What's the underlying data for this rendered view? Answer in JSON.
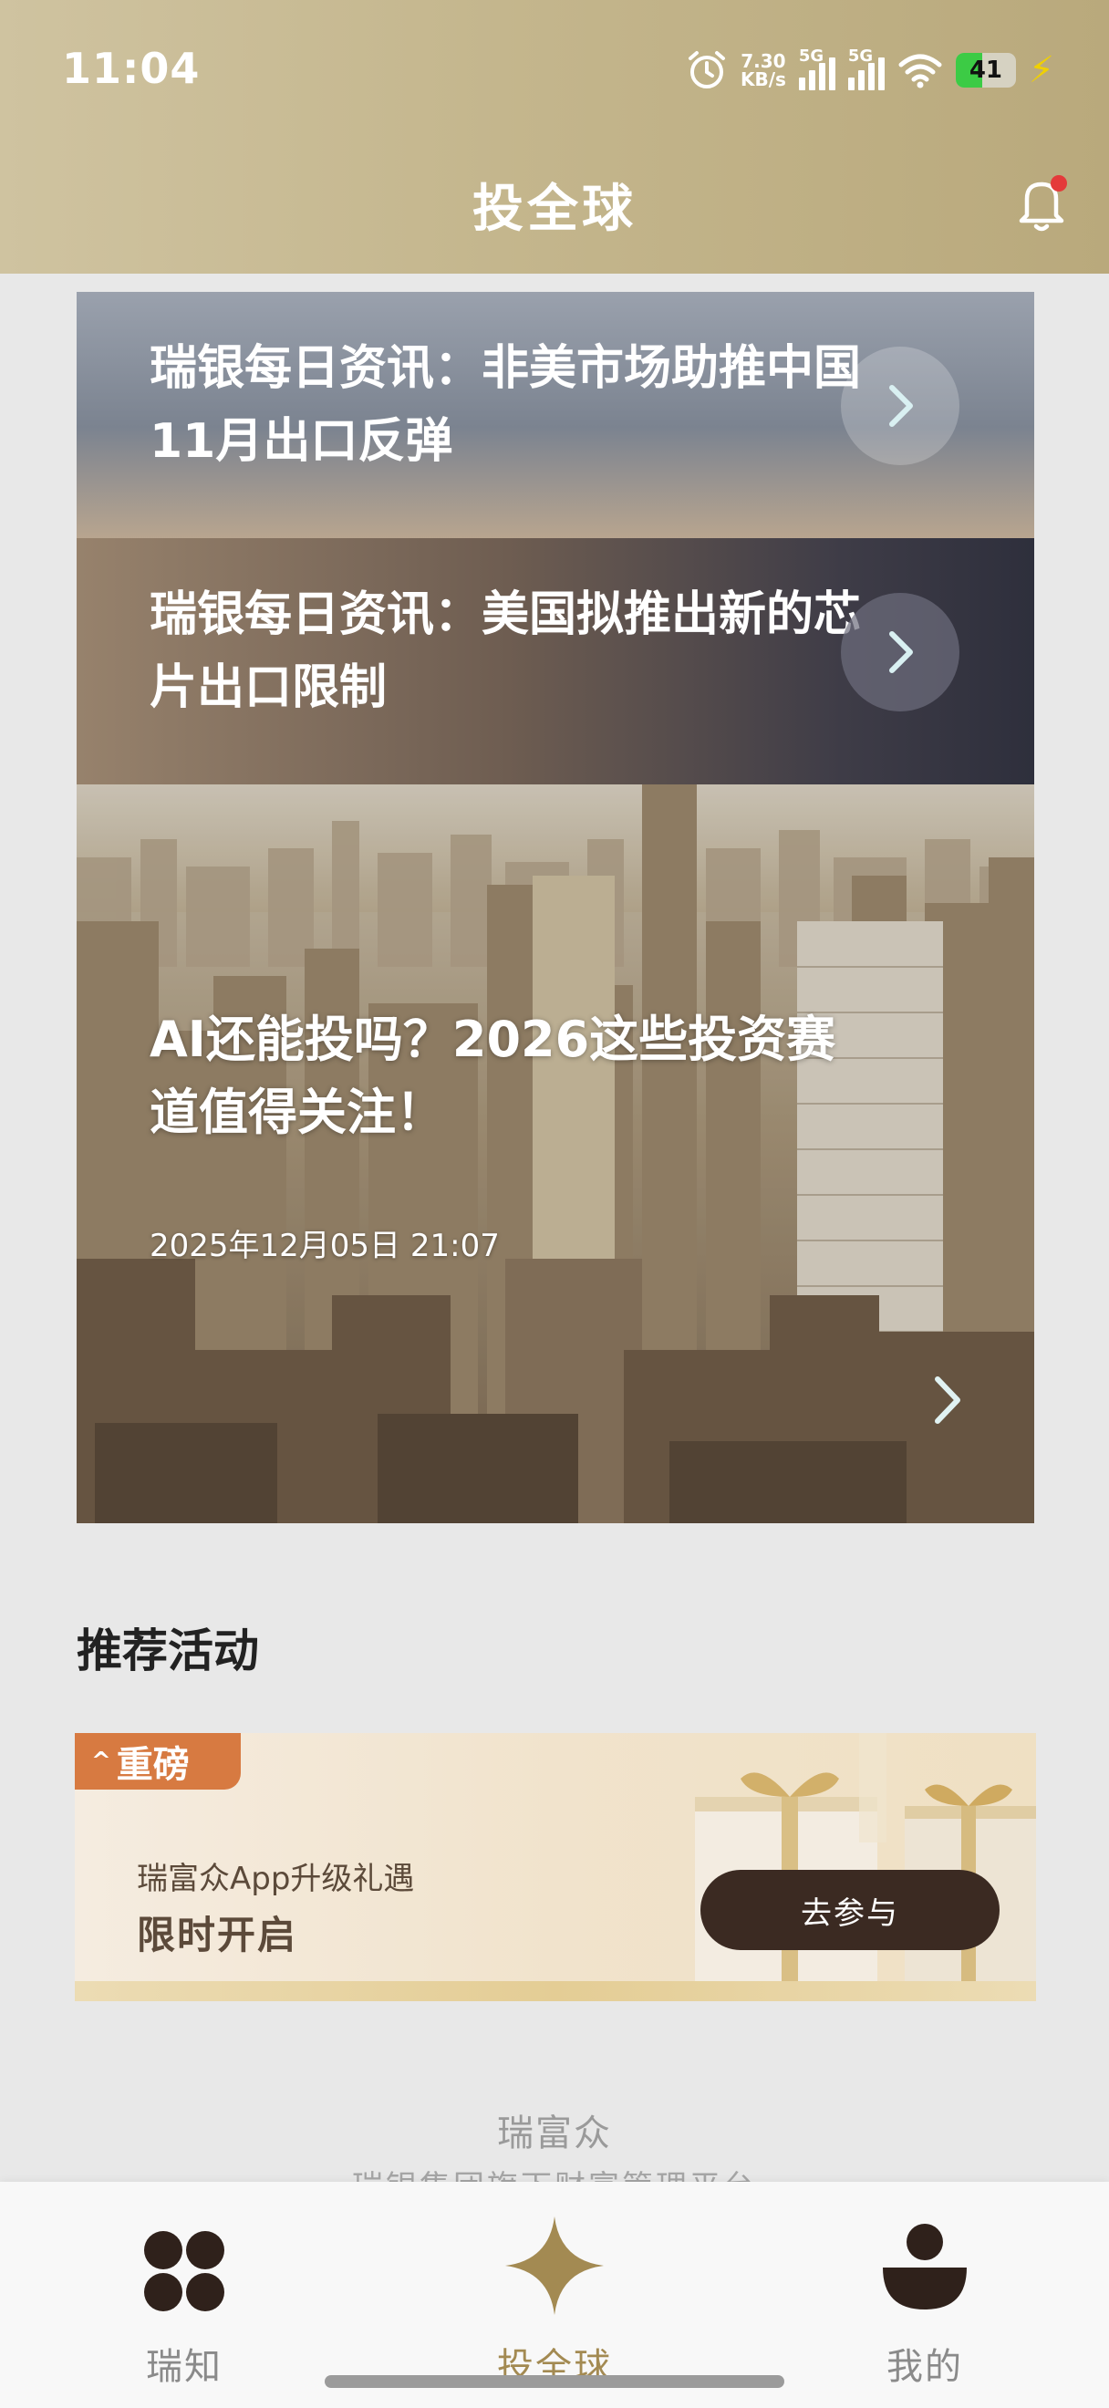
{
  "status_bar": {
    "time": "11:04",
    "net_speed_value": "7.30",
    "net_speed_unit": "KB/s",
    "signal1_label": "5G",
    "signal2_label": "5G",
    "battery": "41",
    "battery_level": 0.41
  },
  "header": {
    "title": "投全球",
    "bell_icon": "bell-icon",
    "has_notification": true
  },
  "news": [
    {
      "title": "瑞银每日资讯：非美市场助推中国11月出口反弹"
    },
    {
      "title": "瑞银每日资讯：美国拟推出新的芯片出口限制"
    }
  ],
  "feature": {
    "title": "AI还能投吗？2026这些投资赛道值得关注！",
    "date": "2025年12月05日 21:07"
  },
  "activities": {
    "section_title": "推荐活动",
    "promo": {
      "badge": "重磅",
      "subtitle": "瑞富众App升级礼遇",
      "headline": "限时开启",
      "button": "去参与"
    }
  },
  "footer": {
    "brand": "瑞富众",
    "subtitle": "瑞银集团旗下财富管理平台"
  },
  "bottom_nav": [
    {
      "label": "瑞知",
      "icon": "four-dots-icon",
      "active": false
    },
    {
      "label": "投全球",
      "icon": "star-icon",
      "active": true
    },
    {
      "label": "我的",
      "icon": "person-icon",
      "active": false
    }
  ],
  "colors": {
    "header_gold": "#c4b68d",
    "accent_gold": "#a38a52",
    "dark_brown": "#3b2a22",
    "badge_orange": "#d77a41"
  }
}
